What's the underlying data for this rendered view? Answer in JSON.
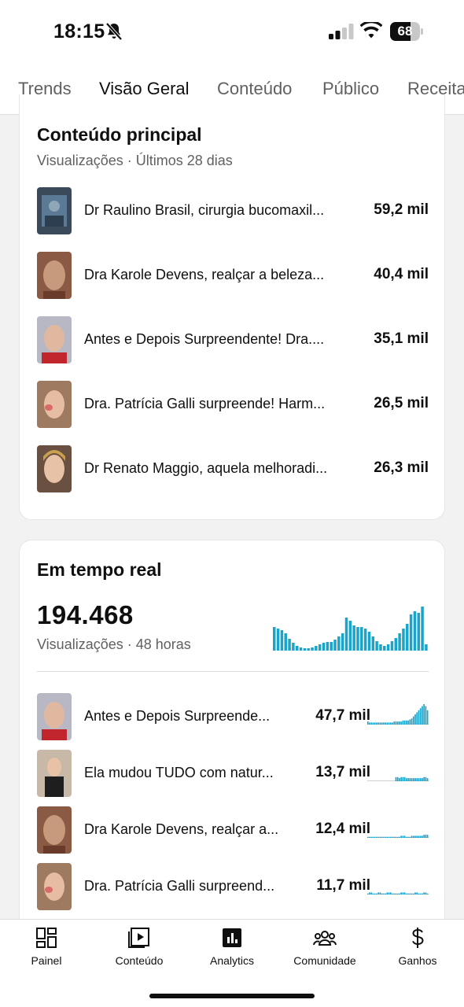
{
  "status": {
    "time": "18:15",
    "battery": "68",
    "battery_level": 0.68
  },
  "tabs": [
    {
      "label": "Trends",
      "active": false
    },
    {
      "label": "Visão Geral",
      "active": true
    },
    {
      "label": "Conteúdo",
      "active": false
    },
    {
      "label": "Público",
      "active": false
    },
    {
      "label": "Receita",
      "active": false
    }
  ],
  "top_content": {
    "title": "Conteúdo principal",
    "subtitle": "Visualizações · Últimos 28 dias",
    "items": [
      {
        "title": "Dr Raulino Brasil, cirurgia bucomaxil...",
        "value": "59,2 mil"
      },
      {
        "title": "Dra Karole Devens, realçar a beleza...",
        "value": "40,4 mil"
      },
      {
        "title": "Antes e Depois Surpreendente! Dra....",
        "value": "35,1 mil"
      },
      {
        "title": "Dra. Patrícia Galli surpreende! Harm...",
        "value": "26,5 mil"
      },
      {
        "title": "Dr Renato Maggio, aquela melhoradi...",
        "value": "26,3 mil"
      }
    ]
  },
  "realtime": {
    "title": "Em tempo real",
    "total": "194.468",
    "subtitle": "Visualizações · 48 horas",
    "bars": [
      30,
      28,
      26,
      22,
      15,
      10,
      6,
      4,
      3,
      3,
      4,
      6,
      8,
      10,
      11,
      11,
      14,
      18,
      22,
      42,
      38,
      32,
      30,
      30,
      28,
      24,
      18,
      12,
      8,
      6,
      8,
      12,
      16,
      22,
      28,
      34,
      46,
      50,
      48,
      56,
      8
    ],
    "items": [
      {
        "title": "Antes e Depois Surpreende...",
        "value": "47,7 mil",
        "spark": [
          3,
          2,
          2,
          2,
          2,
          2,
          2,
          2,
          2,
          2,
          2,
          2,
          2,
          2,
          2,
          3,
          3,
          3,
          3,
          3,
          4,
          4,
          4,
          4,
          5,
          6,
          8,
          10,
          12,
          14,
          16,
          18,
          20,
          18,
          14
        ]
      },
      {
        "title": "Ela mudou TUDO com natur...",
        "value": "13,7 mil",
        "spark": [
          0,
          0,
          0,
          0,
          0,
          0,
          0,
          0,
          0,
          0,
          0,
          0,
          0,
          0,
          0,
          0,
          4,
          4,
          3,
          4,
          4,
          4,
          3,
          3,
          3,
          3,
          3,
          3,
          3,
          3,
          3,
          3,
          4,
          4,
          3
        ]
      },
      {
        "title": "Dra Karole Devens, realçar a...",
        "value": "12,4 mil",
        "spark": [
          1,
          1,
          1,
          1,
          1,
          1,
          1,
          1,
          1,
          1,
          1,
          1,
          1,
          1,
          1,
          1,
          1,
          1,
          1,
          2,
          2,
          2,
          1,
          1,
          1,
          2,
          2,
          2,
          2,
          2,
          2,
          2,
          3,
          3,
          3
        ]
      },
      {
        "title": "Dra. Patrícia Galli surpreend...",
        "value": "11,7 mil",
        "spark": [
          1,
          2,
          2,
          1,
          1,
          1,
          2,
          2,
          1,
          1,
          1,
          2,
          2,
          2,
          1,
          1,
          1,
          1,
          1,
          2,
          2,
          2,
          1,
          1,
          1,
          1,
          1,
          2,
          2,
          1,
          1,
          1,
          2,
          2,
          1
        ]
      }
    ]
  },
  "bottom_nav": [
    {
      "label": "Painel",
      "icon": "dashboard-icon"
    },
    {
      "label": "Conteúdo",
      "icon": "content-icon"
    },
    {
      "label": "Analytics",
      "icon": "analytics-icon"
    },
    {
      "label": "Comunidade",
      "icon": "community-icon"
    },
    {
      "label": "Ganhos",
      "icon": "dollar-icon"
    }
  ],
  "colors": {
    "accent": "#1ba4c9",
    "text": "#0f0f0f",
    "muted": "#606060"
  }
}
